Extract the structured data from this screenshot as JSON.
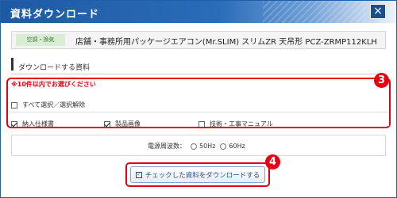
{
  "dialog": {
    "title": "資料ダウンロード",
    "close_glyph": "×",
    "close_icon": "close-icon"
  },
  "product": {
    "badge": "空調・換気",
    "name": "店舗・事務所用パッケージエアコン(Mr.SLIM) スリムZR 天吊形 PCZ-ZRMP112KLH"
  },
  "section": {
    "heading": "ダウンロードする資料"
  },
  "selection": {
    "note": "※10件以内でお選びください",
    "select_all": {
      "label": "すべて選択／選択解除",
      "checked": false
    },
    "items": [
      {
        "label": "納入仕様書",
        "checked": true
      },
      {
        "label": "製品画像",
        "checked": true
      },
      {
        "label": "技術・工事マニュアル",
        "checked": false
      }
    ]
  },
  "frequency": {
    "label": "電源周波数：",
    "options": [
      "50Hz",
      "60Hz"
    ]
  },
  "download_button": {
    "label": "チェックした資料をダウンロードする",
    "icon": "check-square-icon"
  },
  "markers": [
    "3",
    "4"
  ],
  "colors": {
    "accent": "#1e5aa3",
    "highlight": "#e60012"
  }
}
